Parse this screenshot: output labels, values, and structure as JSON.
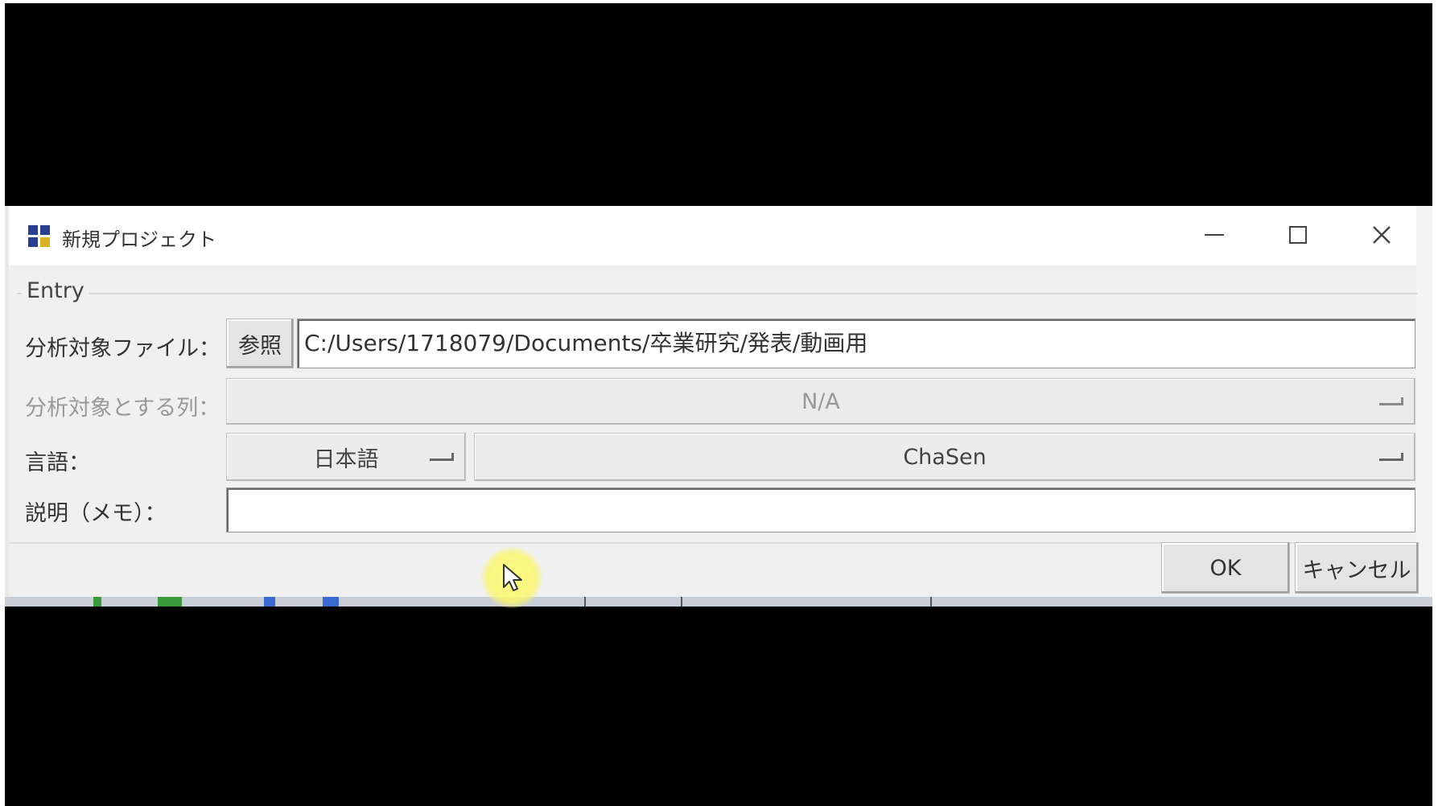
{
  "window": {
    "title": "新規プロジェクト",
    "controls": {
      "minimize": "minimize-icon",
      "maximize": "maximize-icon",
      "close": "close-icon"
    }
  },
  "entry_group": {
    "legend": "Entry",
    "file_row": {
      "label": "分析対象ファイル：",
      "browse_label": "参照",
      "path_value": "C:/Users/1718079/Documents/卒業研究/発表/動画用"
    },
    "column_row": {
      "label": "分析対象とする列：",
      "selected": "N/A"
    },
    "language_row": {
      "label": "言語：",
      "language_selected": "日本語",
      "tagger_selected": "ChaSen"
    },
    "memo_row": {
      "label": "説明（メモ）：",
      "value": ""
    }
  },
  "buttons": {
    "ok_label": "OK",
    "cancel_label": "キャンセル"
  },
  "colors": {
    "letterbox": "#000000",
    "dialog_bg": "#f0f0f0",
    "titlebar_bg": "#ffffff",
    "cursor_highlight": "#f7f27a"
  }
}
